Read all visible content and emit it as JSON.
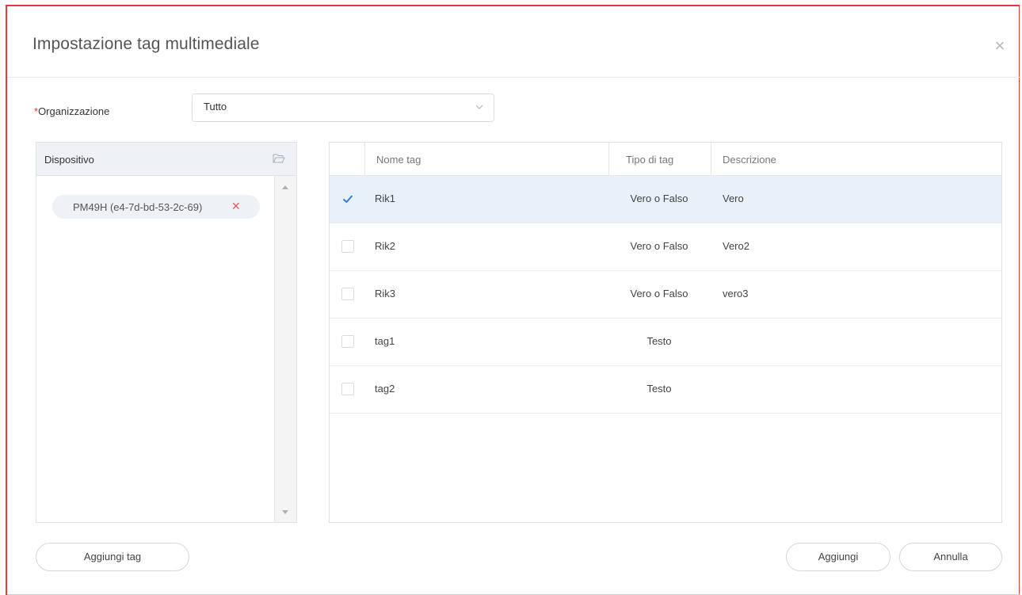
{
  "dialog": {
    "title": "Impostazione tag multimediale",
    "close_icon": "close-icon"
  },
  "organization": {
    "required_mark": "*",
    "label": "Organizzazione",
    "value": "Tutto"
  },
  "devices": {
    "header": "Dispositivo",
    "items": [
      {
        "label": "PM49H (e4-7d-bd-53-2c-69)"
      }
    ]
  },
  "tags": {
    "columns": {
      "name": "Nome tag",
      "type": "Tipo di tag",
      "description": "Descrizione"
    },
    "rows": [
      {
        "name": "Rik1",
        "type": "Vero o Falso",
        "description": "Vero",
        "checked": true
      },
      {
        "name": "Rik2",
        "type": "Vero o Falso",
        "description": "Vero2",
        "checked": false
      },
      {
        "name": "Rik3",
        "type": "Vero o Falso",
        "description": "vero3",
        "checked": false
      },
      {
        "name": "tag1",
        "type": "Testo",
        "description": "",
        "checked": false
      },
      {
        "name": "tag2",
        "type": "Testo",
        "description": "",
        "checked": false
      }
    ]
  },
  "buttons": {
    "add_tag": "Aggiungi tag",
    "add": "Aggiungi",
    "cancel": "Annulla"
  },
  "colors": {
    "accent": "#2f7fd8",
    "required": "#e23b3b",
    "selected_row": "#e8f0fa"
  }
}
